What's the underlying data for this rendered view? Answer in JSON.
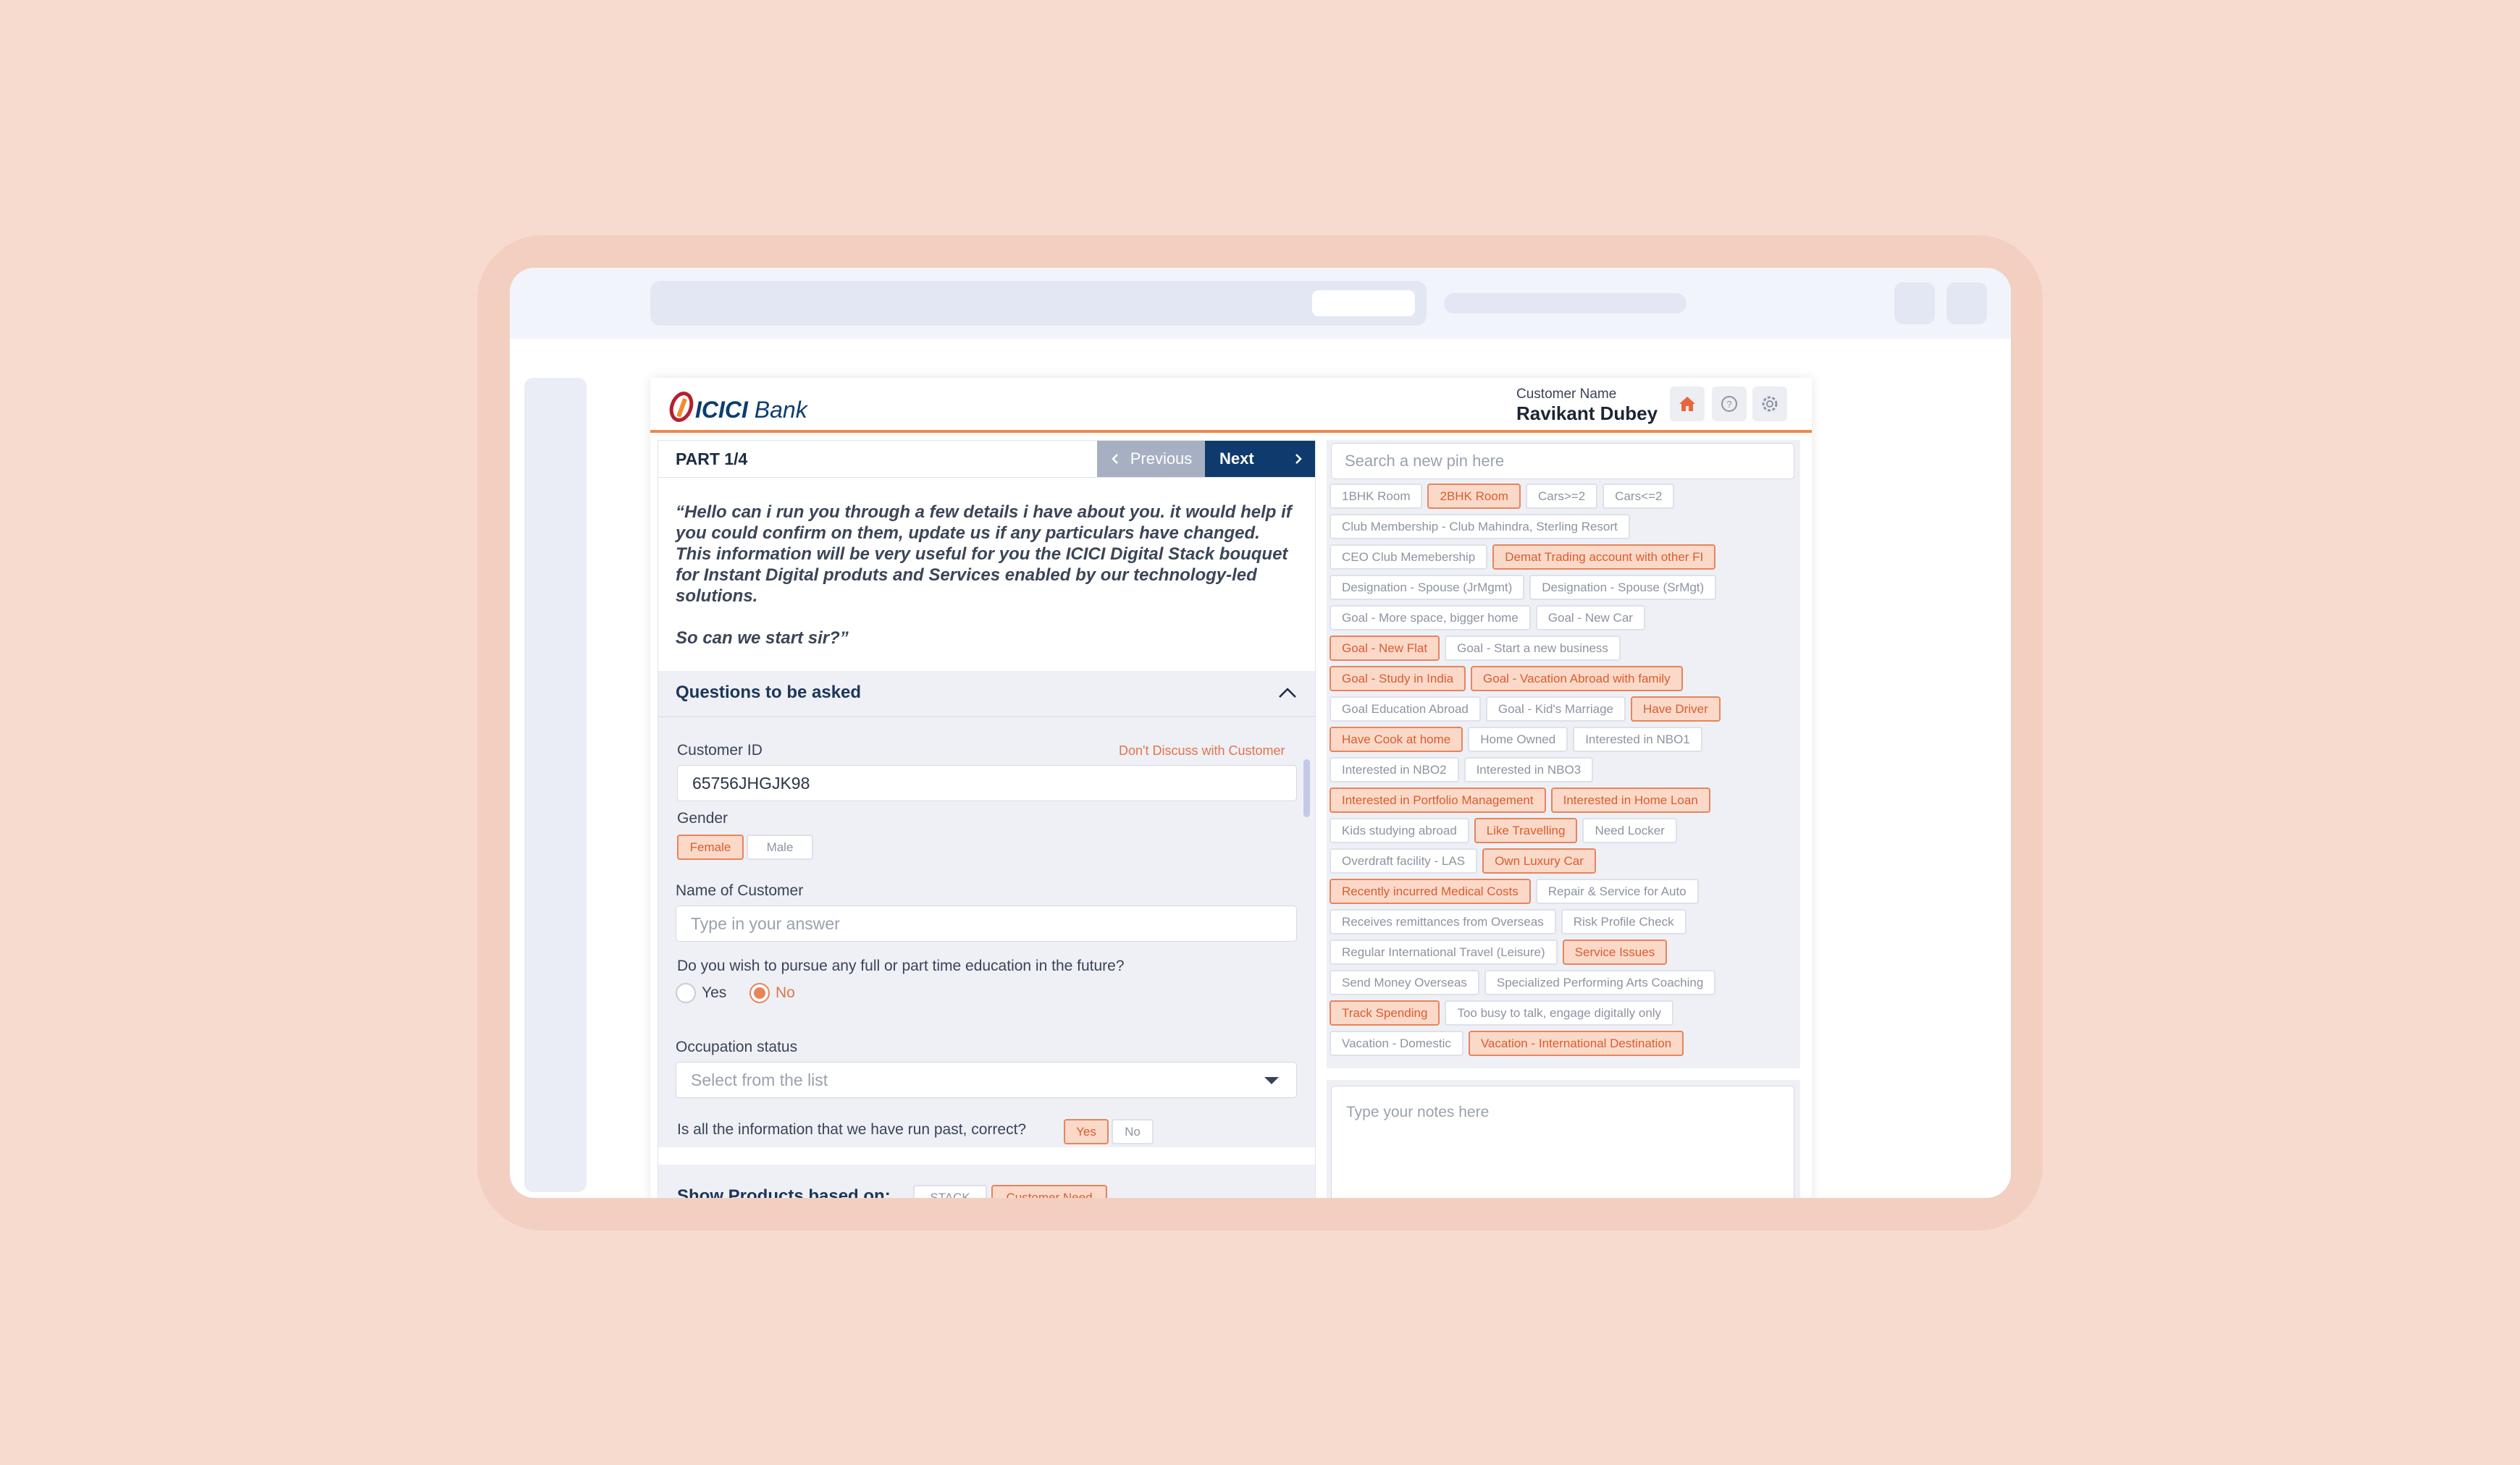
{
  "colors": {
    "background": "#f7dbcf",
    "accent": "#e8845b",
    "brand_navy": "#0e3a6e",
    "selected_chip_bg": "#fbd9c9"
  },
  "brand": {
    "logo_bold": "ICICI",
    "logo_light": "Bank"
  },
  "header": {
    "customer_label": "Customer Name",
    "customer_name": "Ravikant Dubey",
    "icons": [
      "home-icon",
      "help-icon",
      "gear-icon"
    ]
  },
  "wizard": {
    "part": "PART 1/4",
    "previous_label": "Previous",
    "next_label": "Next"
  },
  "script": {
    "paragraph1": "“Hello can i run you through a few details i have about you. it would help if you could confirm on them, update us if any particulars have changed. This information will be very useful for you the ICICI Digital Stack bouquet for Instant Digital produts and Services enabled by our technology-led solutions.",
    "paragraph2": "So can we start sir?”"
  },
  "questions": {
    "title": "Questions to be asked",
    "customer_id_label": "Customer ID",
    "customer_id_value": "65756JHGJK98",
    "dont_discuss": "Don't Discuss with Customer",
    "gender_label": "Gender",
    "gender_options": [
      "Female",
      "Male"
    ],
    "gender_selected": "Female",
    "name_label": "Name of Customer",
    "name_placeholder": "Type in your answer",
    "education_question": "Do you wish to pursue any full or part time education in the future?",
    "education_options": [
      "Yes",
      "No"
    ],
    "education_selected": "No",
    "occupation_label": "Occupation status",
    "occupation_placeholder": "Select from the list",
    "confirm_question": "Is all the information that we have run past, correct?",
    "confirm_options": [
      "Yes",
      "No"
    ],
    "confirm_selected": "Yes"
  },
  "products": {
    "title": "Show Products based on:",
    "options": [
      "STACK",
      "Customer Need"
    ],
    "selected": "Customer Need"
  },
  "pins": {
    "search_placeholder": "Search a new pin here",
    "rows": [
      [
        {
          "label": "1BHK Room",
          "selected": false
        },
        {
          "label": "2BHK Room",
          "selected": true
        },
        {
          "label": "Cars>=2",
          "selected": false
        },
        {
          "label": "Cars<=2",
          "selected": false
        }
      ],
      [
        {
          "label": "Club Membership - Club Mahindra, Sterling Resort",
          "selected": false
        }
      ],
      [
        {
          "label": "CEO Club Memebership",
          "selected": false
        },
        {
          "label": "Demat Trading account with other FI",
          "selected": true
        }
      ],
      [
        {
          "label": "Designation - Spouse (JrMgmt)",
          "selected": false
        },
        {
          "label": "Designation - Spouse (SrMgt)",
          "selected": false
        }
      ],
      [
        {
          "label": "Goal - More space, bigger home",
          "selected": false
        },
        {
          "label": "Goal - New Car",
          "selected": false
        }
      ],
      [
        {
          "label": "Goal - New Flat",
          "selected": true
        },
        {
          "label": "Goal - Start a new business",
          "selected": false
        }
      ],
      [
        {
          "label": "Goal - Study in India",
          "selected": true
        },
        {
          "label": "Goal - Vacation Abroad with family",
          "selected": true
        }
      ],
      [
        {
          "label": "Goal Education Abroad",
          "selected": false
        },
        {
          "label": "Goal - Kid's Marriage",
          "selected": false
        },
        {
          "label": "Have Driver",
          "selected": true
        }
      ],
      [
        {
          "label": "Have Cook at home",
          "selected": true
        },
        {
          "label": "Home Owned",
          "selected": false
        },
        {
          "label": "Interested in NBO1",
          "selected": false
        }
      ],
      [
        {
          "label": "Interested in NBO2",
          "selected": false
        },
        {
          "label": "Interested in NBO3",
          "selected": false
        }
      ],
      [
        {
          "label": "Interested in Portfolio Management",
          "selected": true
        },
        {
          "label": "Interested in Home Loan",
          "selected": true
        }
      ],
      [
        {
          "label": "Kids studying abroad",
          "selected": false
        },
        {
          "label": "Like Travelling",
          "selected": true
        },
        {
          "label": "Need Locker",
          "selected": false
        }
      ],
      [
        {
          "label": "Overdraft facility - LAS",
          "selected": false
        },
        {
          "label": "Own Luxury Car",
          "selected": true
        }
      ],
      [
        {
          "label": "Recently incurred Medical Costs",
          "selected": true
        },
        {
          "label": "Repair & Service for Auto",
          "selected": false
        }
      ],
      [
        {
          "label": "Receives remittances from Overseas",
          "selected": false
        },
        {
          "label": "Risk Profile Check",
          "selected": false
        }
      ],
      [
        {
          "label": "Regular International Travel (Leisure)",
          "selected": false
        },
        {
          "label": "Service Issues",
          "selected": true
        }
      ],
      [
        {
          "label": "Send Money Overseas",
          "selected": false
        },
        {
          "label": "Specialized Performing Arts Coaching",
          "selected": false
        }
      ],
      [
        {
          "label": "Track Spending",
          "selected": true
        },
        {
          "label": "Too busy to talk, engage digitally only",
          "selected": false
        }
      ],
      [
        {
          "label": "Vacation - Domestic",
          "selected": false
        },
        {
          "label": "Vacation - International Destination",
          "selected": true
        }
      ]
    ]
  },
  "notes": {
    "placeholder": "Type your notes here"
  }
}
